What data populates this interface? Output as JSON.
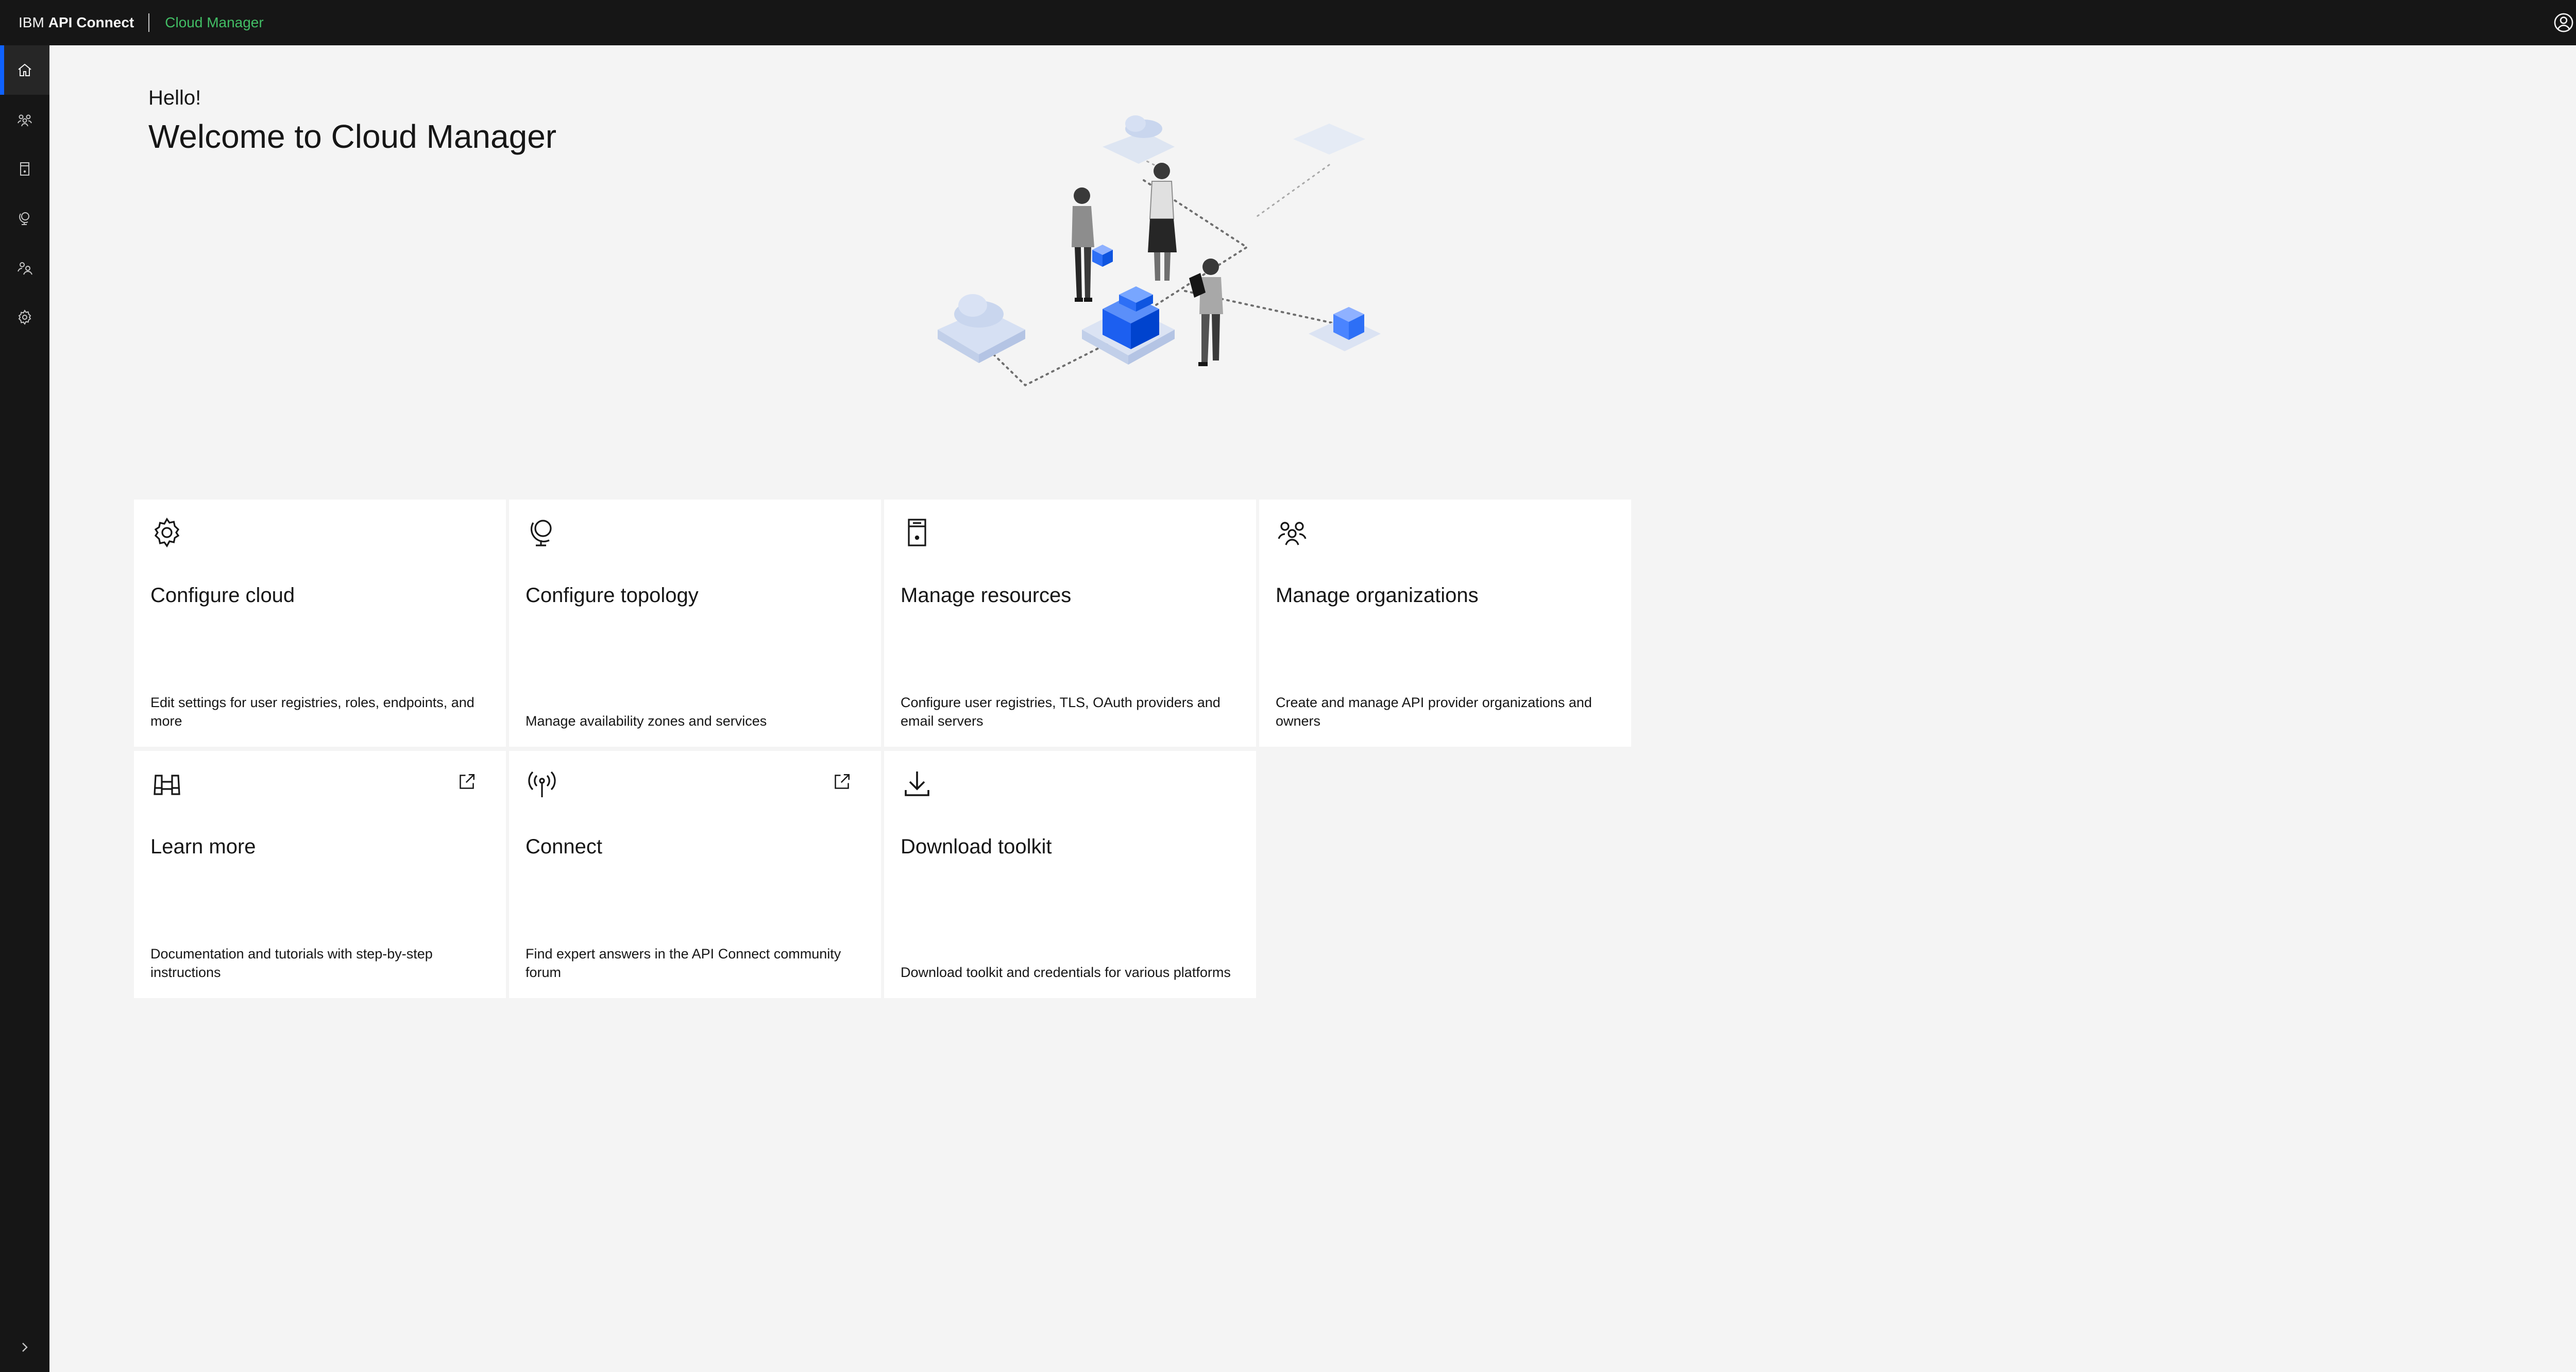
{
  "header": {
    "brand_ibm": "IBM",
    "brand_product": "API Connect",
    "app_name": "Cloud Manager",
    "user_icon": "user-avatar-icon",
    "help_icon": "help-icon"
  },
  "sidenav": {
    "items": [
      {
        "name": "home",
        "icon": "home-icon",
        "active": true
      },
      {
        "name": "members",
        "icon": "members-icon",
        "active": false
      },
      {
        "name": "resources",
        "icon": "resources-icon",
        "active": false
      },
      {
        "name": "topology",
        "icon": "topology-icon",
        "active": false
      },
      {
        "name": "organizations",
        "icon": "organizations-icon",
        "active": false
      },
      {
        "name": "settings",
        "icon": "settings-icon",
        "active": false
      }
    ]
  },
  "main": {
    "greeting": "Hello!",
    "title": "Welcome to Cloud Manager",
    "tiles": [
      {
        "title": "Configure cloud",
        "description": "Edit settings for user registries, roles, endpoints, and more",
        "icon": "settings-icon",
        "external": false
      },
      {
        "title": "Configure topology",
        "description": "Manage availability zones and services",
        "icon": "globe-icon",
        "external": false
      },
      {
        "title": "Manage resources",
        "description": "Configure user registries, TLS, OAuth providers and email servers",
        "icon": "server-icon",
        "external": false
      },
      {
        "title": "Manage organizations",
        "description": "Create and manage API provider organizations and owners",
        "icon": "group-icon",
        "external": false
      },
      {
        "title": "Learn more",
        "description": "Documentation and tutorials with step-by-step instructions",
        "icon": "binoculars-icon",
        "external": true
      },
      {
        "title": "Connect",
        "description": "Find expert answers in the API Connect community forum",
        "icon": "antenna-icon",
        "external": true
      },
      {
        "title": "Download toolkit",
        "description": "Download toolkit and credentials for various platforms",
        "icon": "download-icon",
        "external": false
      }
    ]
  },
  "colors": {
    "header_bg": "#161616",
    "app_name": "#42be65",
    "active_indicator": "#0f62fe",
    "page_bg": "#f4f4f4",
    "tile_bg": "#ffffff"
  }
}
